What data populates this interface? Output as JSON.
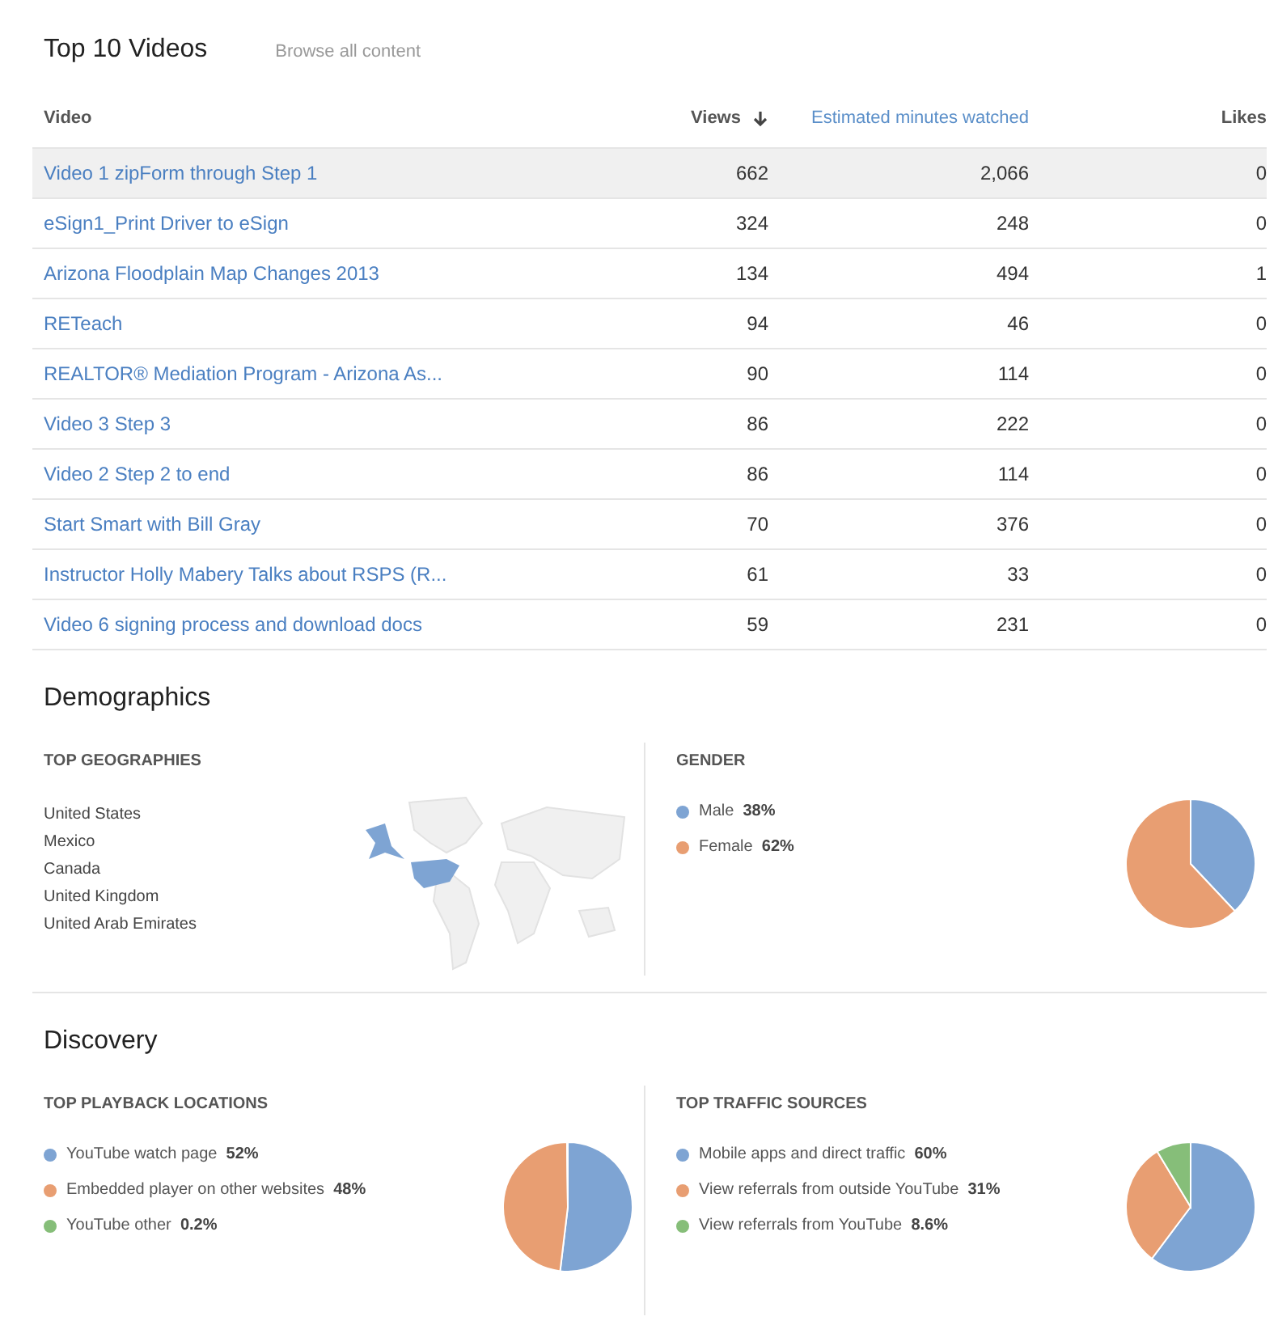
{
  "videos": {
    "title": "Top 10 Videos",
    "browse_link": "Browse all content",
    "columns": [
      {
        "label": "Video",
        "kind": "plain",
        "sorted": false
      },
      {
        "label": "Views",
        "kind": "plain",
        "sorted": true
      },
      {
        "label": "Estimated minutes watched",
        "kind": "link",
        "sorted": false
      },
      {
        "label": "Likes",
        "kind": "plain",
        "sorted": false
      }
    ],
    "rows": [
      {
        "title": "Video 1 zipForm through Step 1",
        "views": "662",
        "minutes": "2,066",
        "likes": "0",
        "selected": true
      },
      {
        "title": "eSign1_Print Driver to eSign",
        "views": "324",
        "minutes": "248",
        "likes": "0",
        "selected": false
      },
      {
        "title": "Arizona Floodplain Map Changes 2013",
        "views": "134",
        "minutes": "494",
        "likes": "1",
        "selected": false
      },
      {
        "title": "RETeach",
        "views": "94",
        "minutes": "46",
        "likes": "0",
        "selected": false
      },
      {
        "title": "REALTOR® Mediation Program - Arizona As...",
        "views": "90",
        "minutes": "114",
        "likes": "0",
        "selected": false
      },
      {
        "title": "Video 3 Step 3",
        "views": "86",
        "minutes": "222",
        "likes": "0",
        "selected": false
      },
      {
        "title": "Video 2 Step 2 to end",
        "views": "86",
        "minutes": "114",
        "likes": "0",
        "selected": false
      },
      {
        "title": "Start Smart with Bill Gray",
        "views": "70",
        "minutes": "376",
        "likes": "0",
        "selected": false
      },
      {
        "title": "Instructor Holly Mabery Talks about RSPS (R...",
        "views": "61",
        "minutes": "33",
        "likes": "0",
        "selected": false
      },
      {
        "title": "Video 6 signing process and download docs",
        "views": "59",
        "minutes": "231",
        "likes": "0",
        "selected": false
      }
    ]
  },
  "sections": [
    {
      "title": "Demographics",
      "panels": [
        {
          "kind": "geo",
          "title": "TOP GEOGRAPHIES",
          "countries": [
            "United States",
            "Mexico",
            "Canada",
            "United Kingdom",
            "United Arab Emirates"
          ]
        },
        {
          "kind": "pie",
          "title": "GENDER",
          "legend": [
            {
              "value": "38%",
              "color": "#7ea4d3"
            },
            {
              "value": "62%",
              "color": "#e89e72"
            }
          ],
          "chart_data": {
            "type": "pie",
            "categories": [
              "Male",
              "Female"
            ],
            "values": [
              38,
              62
            ]
          }
        }
      ]
    },
    {
      "title": "Discovery",
      "panels": [
        {
          "kind": "pie",
          "title": "TOP PLAYBACK LOCATIONS",
          "legend": [
            {
              "value": "52%",
              "color": "#7ea4d3"
            },
            {
              "value": "48%",
              "color": "#e89e72"
            },
            {
              "value": "0.2%",
              "color": "#86be79"
            }
          ],
          "chart_data": {
            "type": "pie",
            "categories": [
              "YouTube watch page",
              "Embedded player on other websites",
              "YouTube other"
            ],
            "values": [
              52,
              48,
              0.2
            ]
          }
        },
        {
          "kind": "pie",
          "title": "TOP TRAFFIC SOURCES",
          "legend": [
            {
              "value": "60%",
              "color": "#7ea4d3"
            },
            {
              "value": "31%",
              "color": "#e89e72"
            },
            {
              "value": "8.6%",
              "color": "#86be79"
            }
          ],
          "chart_data": {
            "type": "pie",
            "categories": [
              "Mobile apps and direct traffic",
              "View referrals from outside YouTube",
              "View referrals from YouTube"
            ],
            "values": [
              60,
              31,
              8.6
            ]
          }
        }
      ]
    }
  ]
}
